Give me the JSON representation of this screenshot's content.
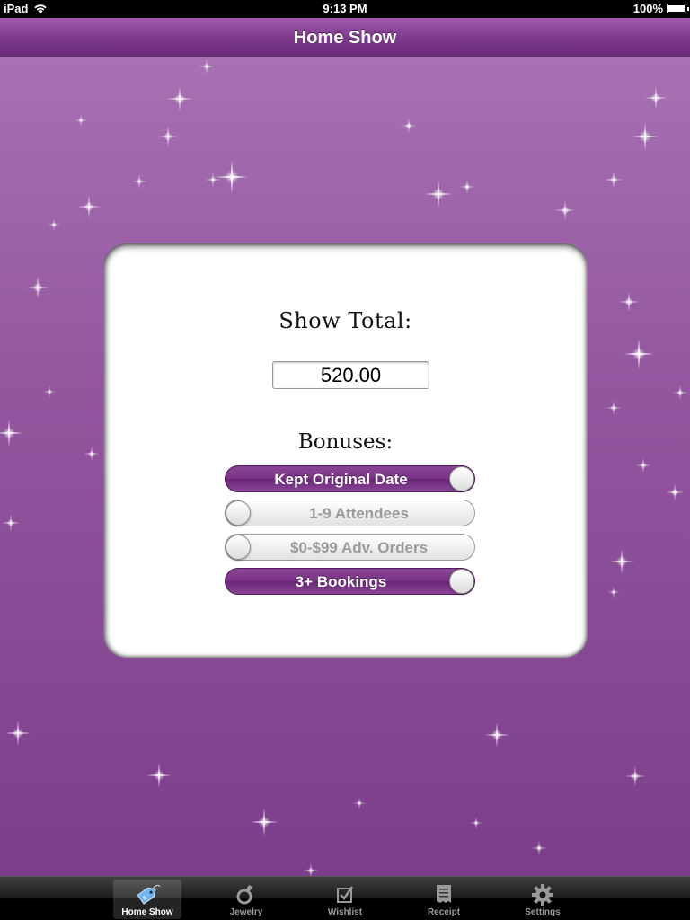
{
  "status_bar": {
    "device": "iPad",
    "time": "9:13 PM",
    "battery": "100%",
    "battery_level": 1.0
  },
  "nav": {
    "title": "Home Show"
  },
  "card": {
    "show_total_label": "Show Total:",
    "show_total_value": "520.00",
    "bonuses_label": "Bonuses:",
    "bonuses": [
      {
        "label": "Kept Original Date",
        "on": true
      },
      {
        "label": "1-9 Attendees",
        "on": false
      },
      {
        "label": "$0-$99 Adv. Orders",
        "on": false
      },
      {
        "label": "3+ Bookings",
        "on": true
      }
    ]
  },
  "tab_bar": {
    "tabs": [
      {
        "label": "Home Show",
        "icon": "price-tag-icon",
        "active": true
      },
      {
        "label": "Jewelry",
        "icon": "ring-icon",
        "active": false
      },
      {
        "label": "Wishlist",
        "icon": "checkbox-icon",
        "active": false
      },
      {
        "label": "Receipt",
        "icon": "receipt-icon",
        "active": false
      },
      {
        "label": "Settings",
        "icon": "gear-icon",
        "active": false
      }
    ]
  },
  "colors": {
    "accent_purple": "#7b3387",
    "background_purple": "#93569f"
  }
}
